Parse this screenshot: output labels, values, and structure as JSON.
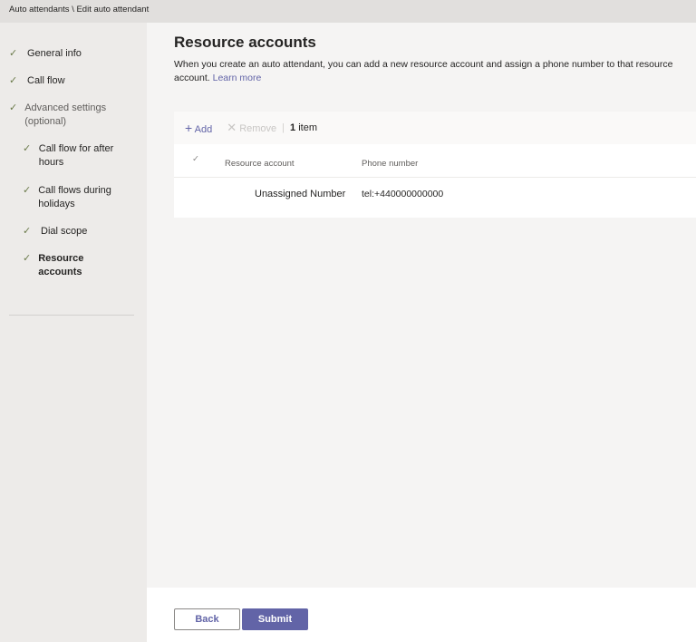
{
  "breadcrumb": "Auto attendants \\ Edit auto attendant",
  "sidebar": {
    "items": [
      {
        "label": "General info"
      },
      {
        "label": "Call flow"
      },
      {
        "label": "Advanced settings (optional)"
      },
      {
        "label": "Call flow for after hours"
      },
      {
        "label": "Call flows during holidays"
      },
      {
        "label": "Dial scope"
      },
      {
        "label": "Resource accounts"
      }
    ],
    "check": "✓"
  },
  "main": {
    "title": "Resource accounts",
    "description": "When you create an auto attendant, you can add a new resource account and assign a phone number to that resource account.",
    "learn_more": "Learn more"
  },
  "toolbar": {
    "add": "Add",
    "remove": "Remove",
    "count_num": "1",
    "count_label": "item"
  },
  "table": {
    "headers": [
      "Resource account",
      "Phone number"
    ],
    "rows": [
      {
        "account": "Unassigned Number",
        "phone": "tel:+440000000000"
      }
    ]
  },
  "footer": {
    "back": "Back",
    "submit": "Submit"
  },
  "colors": {
    "accent": "#6264a7"
  }
}
